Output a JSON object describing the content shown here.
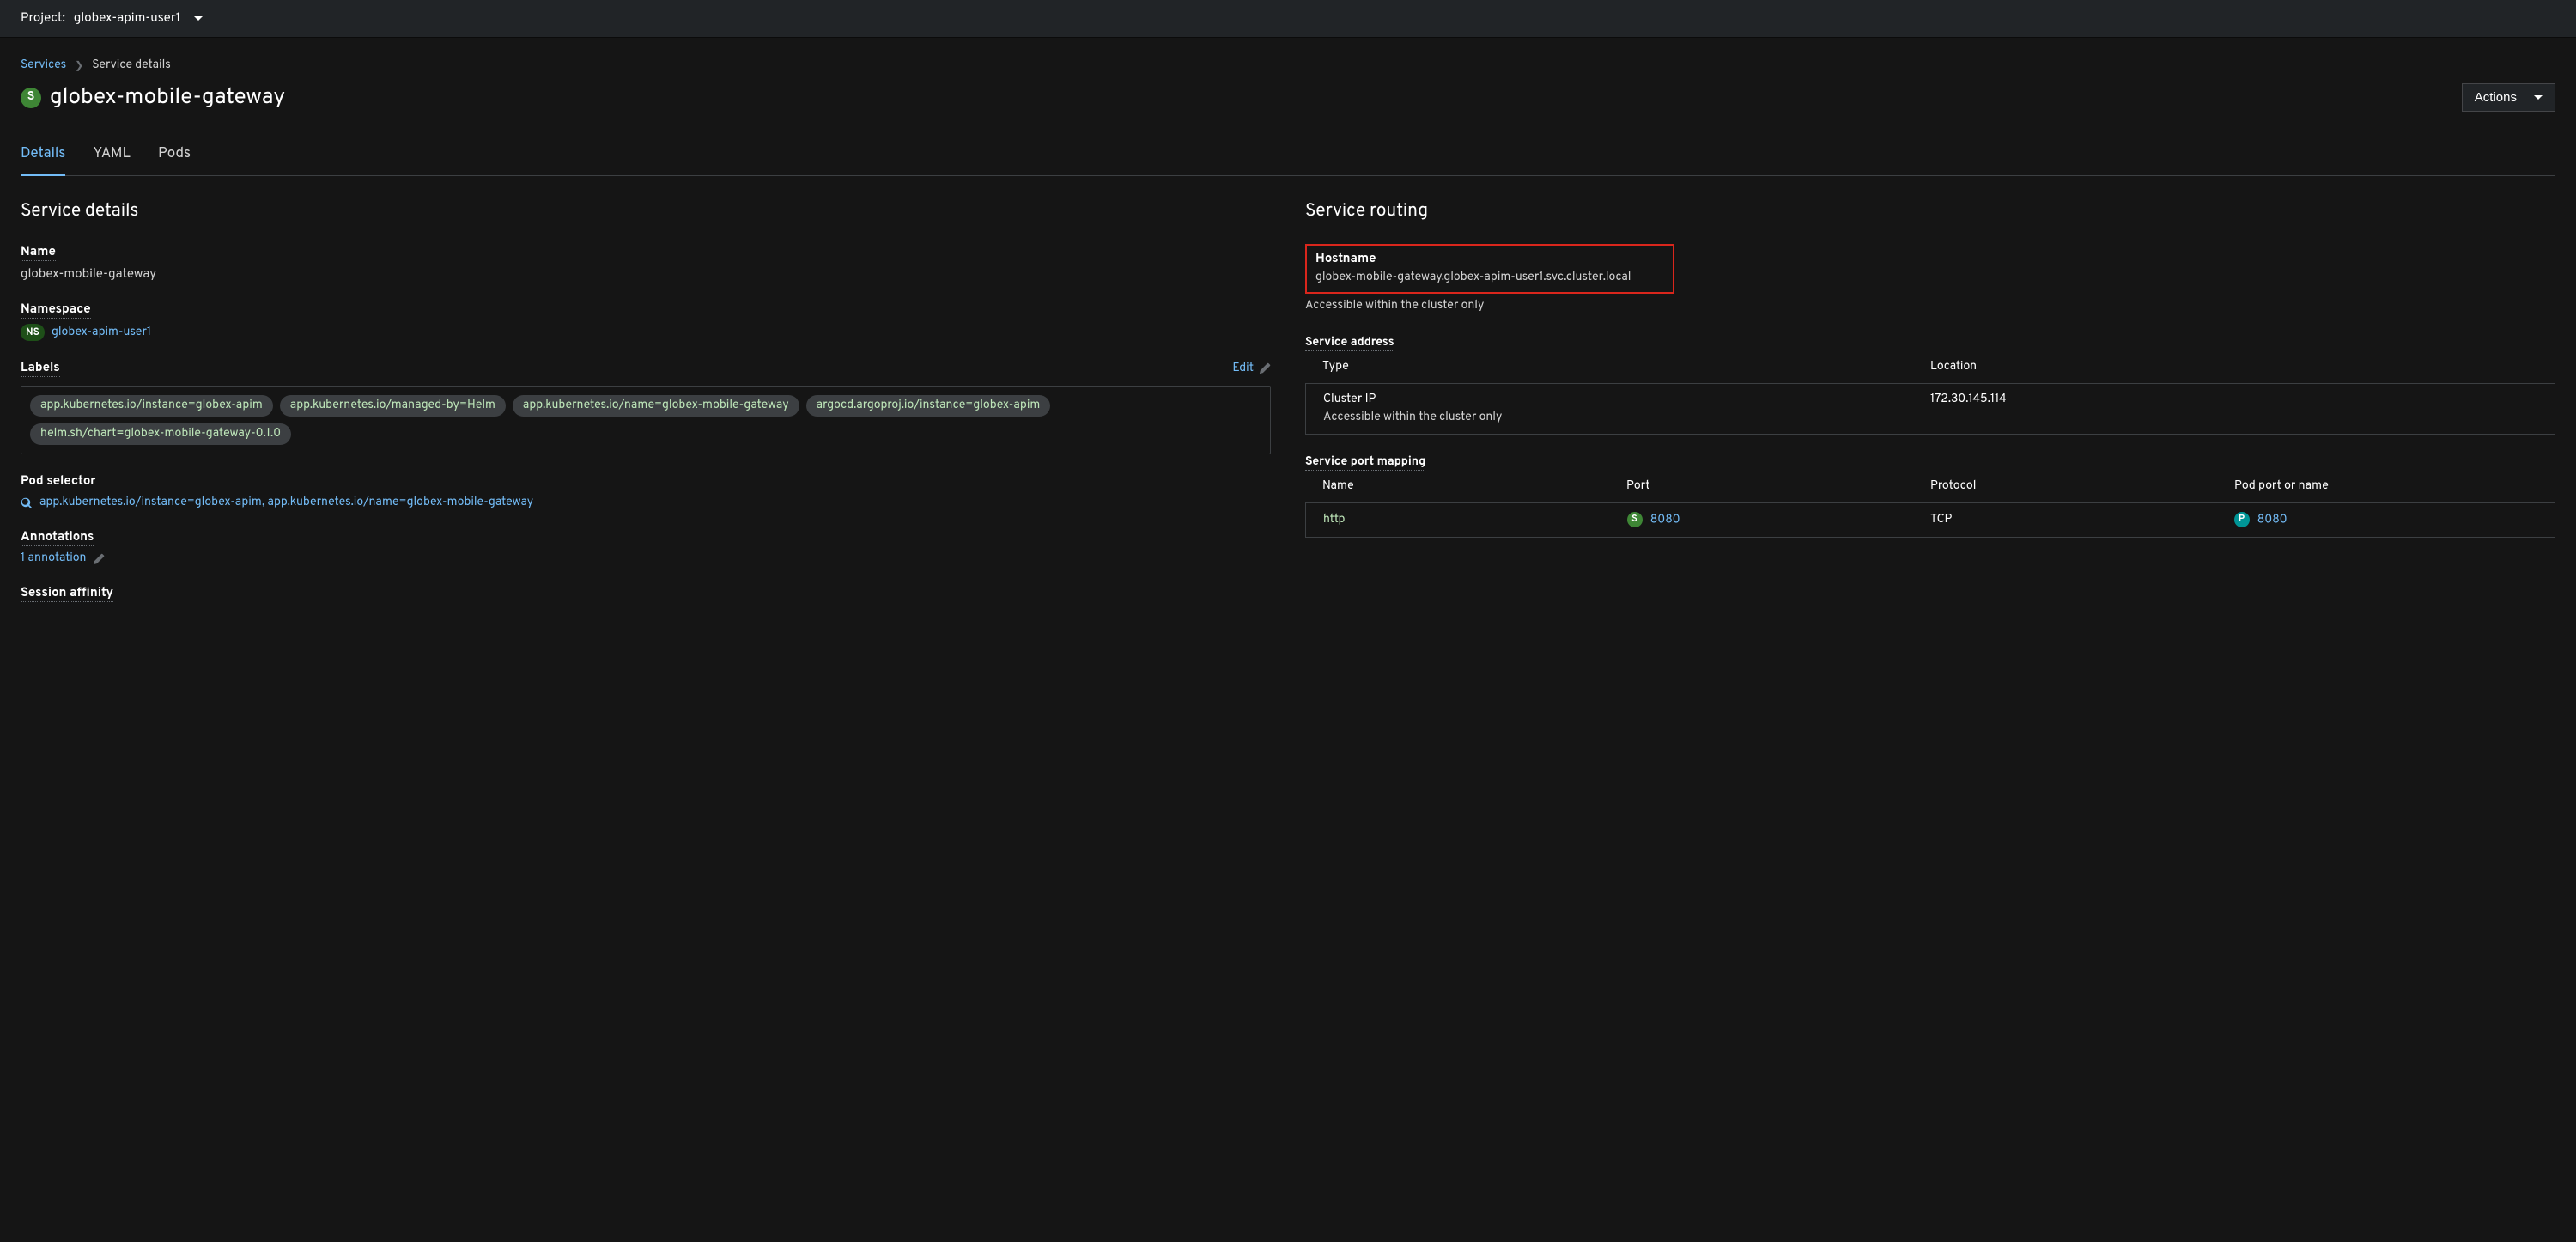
{
  "topbar": {
    "project_prefix": "Project:",
    "project_name": "globex-apim-user1"
  },
  "breadcrumb": {
    "services": "Services",
    "current": "Service details"
  },
  "title": "globex-mobile-gateway",
  "actions_label": "Actions",
  "tabs": [
    {
      "label": "Details",
      "active": true
    },
    {
      "label": "YAML",
      "active": false
    },
    {
      "label": "Pods",
      "active": false
    }
  ],
  "details": {
    "section_title": "Service details",
    "name_label": "Name",
    "name_value": "globex-mobile-gateway",
    "namespace_label": "Namespace",
    "namespace_badge": "NS",
    "namespace_value": "globex-apim-user1",
    "labels_label": "Labels",
    "edit_label": "Edit",
    "labels": [
      "app.kubernetes.io/instance=globex-apim",
      "app.kubernetes.io/managed-by=Helm",
      "app.kubernetes.io/name=globex-mobile-gateway",
      "argocd.argoproj.io/instance=globex-apim",
      "helm.sh/chart=globex-mobile-gateway-0.1.0"
    ],
    "pod_selector_label": "Pod selector",
    "pod_selector_value": "app.kubernetes.io/instance=globex-apim, app.kubernetes.io/name=globex-mobile-gateway",
    "annotations_label": "Annotations",
    "annotations_value": "1 annotation",
    "session_affinity_label": "Session affinity"
  },
  "routing": {
    "section_title": "Service routing",
    "hostname_label": "Hostname",
    "hostname_value": "globex-mobile-gateway.globex-apim-user1.svc.cluster.local",
    "accessible_note": "Accessible within the cluster only",
    "service_address_label": "Service address",
    "addr_type_header": "Type",
    "addr_location_header": "Location",
    "addr_type_value": "Cluster IP",
    "addr_location_value": "172.30.145.114",
    "addr_note": "Accessible within the cluster only",
    "port_mapping_label": "Service port mapping",
    "port_headers": {
      "name": "Name",
      "port": "Port",
      "protocol": "Protocol",
      "pod_port": "Pod port or name"
    },
    "port_row": {
      "name": "http",
      "port": "8080",
      "protocol": "TCP",
      "pod_port": "8080"
    }
  }
}
